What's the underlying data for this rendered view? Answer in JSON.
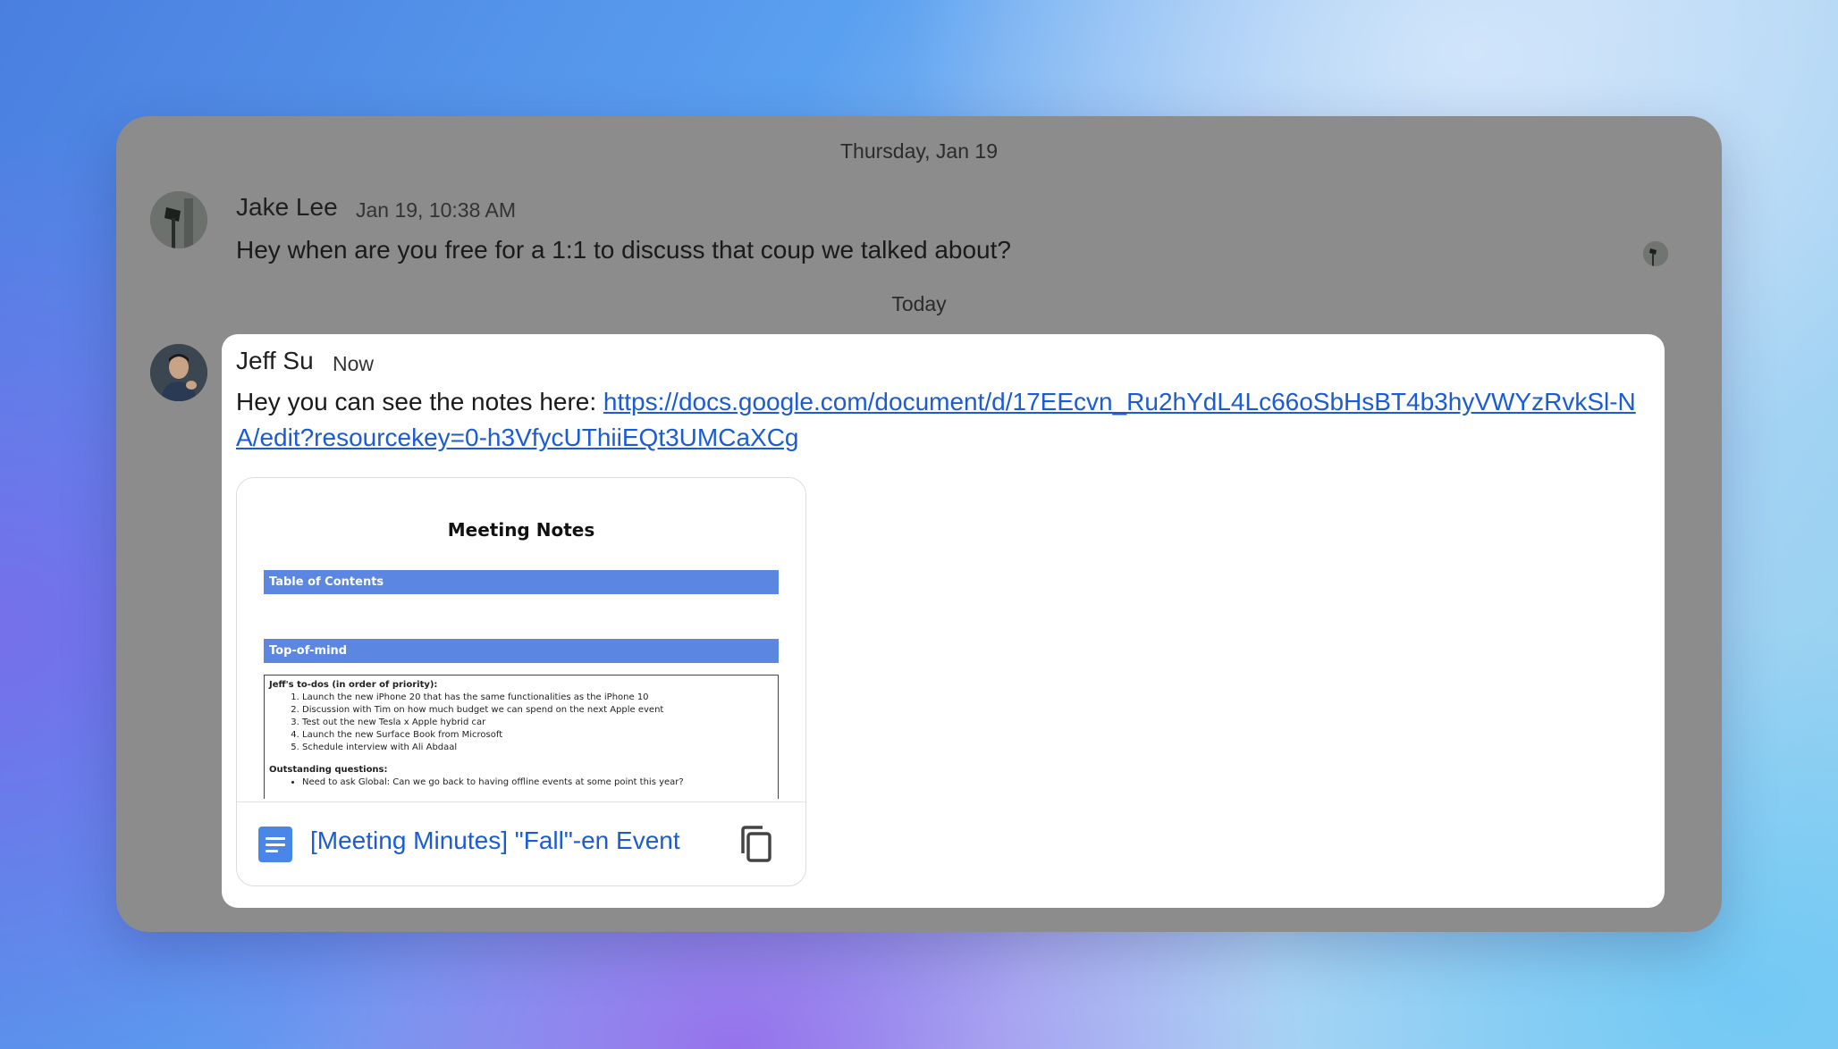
{
  "chat": {
    "date_separator_1": "Thursday, Jan 19",
    "date_separator_2": "Today",
    "messages": [
      {
        "sender": "Jake Lee",
        "timestamp": "Jan 19, 10:38 AM",
        "text": "Hey when are you free for a 1:1 to discuss that coup we talked about?",
        "avatar_icon": "user-avatar"
      },
      {
        "sender": "Jeff Su",
        "timestamp": "Now",
        "text_prefix": "Hey you can see the notes here: ",
        "link": "https://docs.google.com/document/d/17EEcvn_Ru2hYdL4Lc66oSbHsBT4b3hyVWYzRvkSl-NA/edit?resourcekey=0-h3VfycUThiiEQt3UMCaXCg",
        "avatar_icon": "user-avatar"
      }
    ]
  },
  "doc_card": {
    "preview": {
      "title": "Meeting Notes",
      "section_1": "Table of Contents",
      "section_2": "Top-of-mind",
      "todos_header": "Jeff's to-dos (in order of priority):",
      "todos": [
        "Launch the new iPhone 20 that has the same functionalities as the iPhone 10",
        "Discussion with Tim on how much budget we can spend on the next Apple event",
        "Test out the new Tesla x Apple hybrid car",
        "Launch the new Surface Book from Microsoft",
        "Schedule interview with Ali Abdaal"
      ],
      "questions_header": "Outstanding questions:",
      "questions": [
        "Need to ask Global: Can we go back to having offline events at some point this year?"
      ]
    },
    "file_name": "[Meeting Minutes] \"Fall\"-en Event",
    "file_icon": "google-docs-icon",
    "action_icon": "copy-icon"
  },
  "colors": {
    "window_bg": "#8c8c8c",
    "highlight_bg": "#ffffff",
    "link": "#1a5cd6",
    "doc_bar": "#5b87e2",
    "docs_icon": "#4a86e8"
  }
}
